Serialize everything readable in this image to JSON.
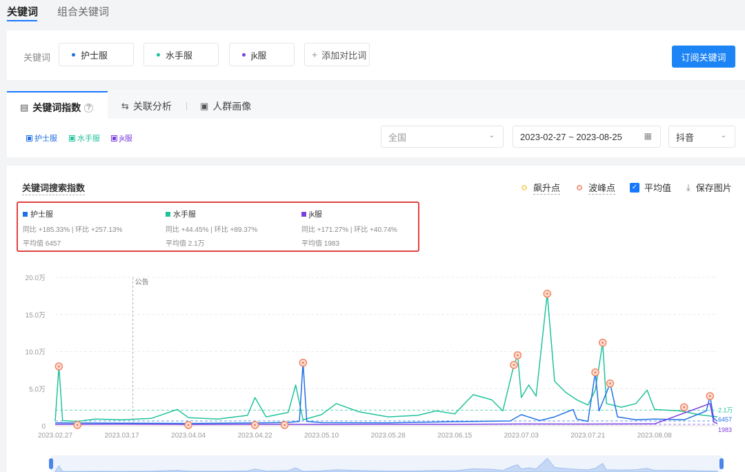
{
  "top_tabs": [
    "关键词",
    "组合关键词"
  ],
  "keyword_bar": {
    "label": "关键词",
    "keywords": [
      {
        "name": "护士服",
        "color": "#1f6fe5"
      },
      {
        "name": "水手服",
        "color": "#1fc29a"
      },
      {
        "name": "jk服",
        "color": "#7b3fe0"
      }
    ],
    "add_label": "添加对比词",
    "subscribe_label": "订阅关键词"
  },
  "analysis_tabs": [
    {
      "label": "关键词指数",
      "icon": "chart-icon"
    },
    {
      "label": "关联分析",
      "icon": "swap-icon"
    },
    {
      "label": "人群画像",
      "icon": "portrait-icon"
    }
  ],
  "filters": {
    "region": "全国",
    "date_range": "2023-02-27 ~ 2023-08-25",
    "platform": "抖音"
  },
  "chart_options": {
    "soaring_label": "飙升点",
    "peak_label": "波峰点",
    "average_label": "平均值",
    "save_label": "保存图片"
  },
  "stats": [
    {
      "name": "护士服",
      "yoy": "同比 +185.33%",
      "mom": "环比 +257.13%",
      "avg": "平均值 6457"
    },
    {
      "name": "水手服",
      "yoy": "同比 +44.45%",
      "mom": "环比 +89.37%",
      "avg": "平均值 2.1万"
    },
    {
      "name": "jk服",
      "yoy": "同比 +171.27%",
      "mom": "环比 +40.74%",
      "avg": "平均值 1983"
    }
  ],
  "chart_data": {
    "type": "line",
    "title": "关键词搜索指数",
    "y_ticks": [
      "0",
      "5.0万",
      "10.0万",
      "15.0万",
      "20.0万"
    ],
    "ylim": [
      0,
      200000
    ],
    "x_tick_labels": [
      "2023.02.27",
      "2023.03.17",
      "2023.04.04",
      "2023.04.22",
      "2023.05.10",
      "2023.05.28",
      "2023.06.15",
      "2023.07.03",
      "2023.07.21",
      "2023.08.08"
    ],
    "annotation": "公告",
    "avg_labels": [
      "2.1万",
      "6457",
      "1983"
    ],
    "series": [
      {
        "name": "护士服",
        "color": "#1f6fe5",
        "average": 6457,
        "points": [
          [
            "2023-02-27",
            4000
          ],
          [
            "2023-03-17",
            3500
          ],
          [
            "2023-04-04",
            3200
          ],
          [
            "2023-04-22",
            3800
          ],
          [
            "2023-05-01",
            4500
          ],
          [
            "2023-05-04",
            6000
          ],
          [
            "2023-05-05",
            85000
          ],
          [
            "2023-05-06",
            6000
          ],
          [
            "2023-05-10",
            4200
          ],
          [
            "2023-05-28",
            4000
          ],
          [
            "2023-06-15",
            5500
          ],
          [
            "2023-06-30",
            6500
          ],
          [
            "2023-07-03",
            15000
          ],
          [
            "2023-07-08",
            7000
          ],
          [
            "2023-07-12",
            12000
          ],
          [
            "2023-07-17",
            22000
          ],
          [
            "2023-07-18",
            9000
          ],
          [
            "2023-07-21",
            6000
          ],
          [
            "2023-07-23",
            72000
          ],
          [
            "2023-07-24",
            20000
          ],
          [
            "2023-07-27",
            57000
          ],
          [
            "2023-07-29",
            12000
          ],
          [
            "2023-08-03",
            8000
          ],
          [
            "2023-08-08",
            9000
          ],
          [
            "2023-08-16",
            8000
          ],
          [
            "2023-08-22",
            20000
          ],
          [
            "2023-08-23",
            40000
          ],
          [
            "2023-08-24",
            10000
          ],
          [
            "2023-08-25",
            6000
          ]
        ]
      },
      {
        "name": "水手服",
        "color": "#1fc29a",
        "average": 21000,
        "points": [
          [
            "2023-02-27",
            6000
          ],
          [
            "2023-02-28",
            80000
          ],
          [
            "2023-03-01",
            7000
          ],
          [
            "2023-03-05",
            6000
          ],
          [
            "2023-03-10",
            9000
          ],
          [
            "2023-03-17",
            8000
          ],
          [
            "2023-03-25",
            10000
          ],
          [
            "2023-04-01",
            22000
          ],
          [
            "2023-04-04",
            11000
          ],
          [
            "2023-04-12",
            9000
          ],
          [
            "2023-04-20",
            14000
          ],
          [
            "2023-04-22",
            38000
          ],
          [
            "2023-04-25",
            12000
          ],
          [
            "2023-05-01",
            18000
          ],
          [
            "2023-05-03",
            55000
          ],
          [
            "2023-05-05",
            8000
          ],
          [
            "2023-05-10",
            15000
          ],
          [
            "2023-05-14",
            30000
          ],
          [
            "2023-05-20",
            19000
          ],
          [
            "2023-05-28",
            12000
          ],
          [
            "2023-06-05",
            14000
          ],
          [
            "2023-06-10",
            20000
          ],
          [
            "2023-06-15",
            16000
          ],
          [
            "2023-06-20",
            42000
          ],
          [
            "2023-06-25",
            35000
          ],
          [
            "2023-06-28",
            20000
          ],
          [
            "2023-07-01",
            82000
          ],
          [
            "2023-07-02",
            95000
          ],
          [
            "2023-07-03",
            38000
          ],
          [
            "2023-07-05",
            55000
          ],
          [
            "2023-07-07",
            40000
          ],
          [
            "2023-07-10",
            178000
          ],
          [
            "2023-07-12",
            60000
          ],
          [
            "2023-07-15",
            45000
          ],
          [
            "2023-07-18",
            35000
          ],
          [
            "2023-07-21",
            28000
          ],
          [
            "2023-07-23",
            48000
          ],
          [
            "2023-07-25",
            112000
          ],
          [
            "2023-07-26",
            30000
          ],
          [
            "2023-07-30",
            25000
          ],
          [
            "2023-08-03",
            30000
          ],
          [
            "2023-08-06",
            48000
          ],
          [
            "2023-08-08",
            22000
          ],
          [
            "2023-08-15",
            20000
          ],
          [
            "2023-08-20",
            15000
          ],
          [
            "2023-08-25",
            12000
          ]
        ]
      },
      {
        "name": "jk服",
        "color": "#7b3fe0",
        "average": 1983,
        "points": [
          [
            "2023-02-27",
            2000
          ],
          [
            "2023-03-17",
            2200
          ],
          [
            "2023-04-04",
            1800
          ],
          [
            "2023-04-22",
            2000
          ],
          [
            "2023-05-10",
            1900
          ],
          [
            "2023-05-28",
            2100
          ],
          [
            "2023-06-15",
            2000
          ],
          [
            "2023-07-03",
            2400
          ],
          [
            "2023-07-21",
            2300
          ],
          [
            "2023-08-08",
            2500
          ],
          [
            "2023-08-23",
            30000
          ],
          [
            "2023-08-24",
            5000
          ],
          [
            "2023-08-25",
            3000
          ]
        ]
      }
    ],
    "peaks": [
      [
        "2023-02-28",
        80000
      ],
      [
        "2023-03-05",
        1000
      ],
      [
        "2023-04-04",
        1000
      ],
      [
        "2023-04-22",
        1000
      ],
      [
        "2023-04-30",
        1000
      ],
      [
        "2023-05-05",
        85000
      ],
      [
        "2023-07-01",
        82000
      ],
      [
        "2023-07-02",
        95000
      ],
      [
        "2023-07-10",
        178000
      ],
      [
        "2023-07-23",
        72000
      ],
      [
        "2023-07-25",
        112000
      ],
      [
        "2023-07-27",
        57000
      ],
      [
        "2023-08-16",
        25000
      ],
      [
        "2023-08-23",
        40000
      ]
    ]
  }
}
